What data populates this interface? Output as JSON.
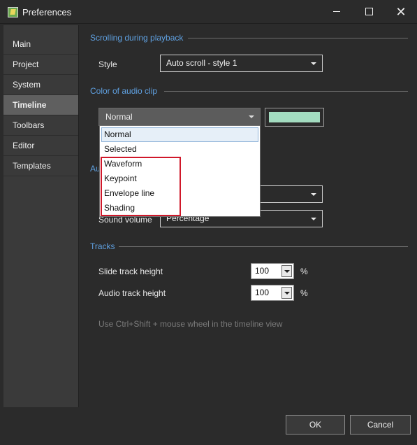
{
  "window": {
    "title": "Preferences",
    "minimize_icon": "minimize-icon",
    "maximize_icon": "maximize-icon",
    "close_glyph": "✕"
  },
  "sidebar": {
    "items": [
      {
        "label": "Main"
      },
      {
        "label": "Project"
      },
      {
        "label": "System"
      },
      {
        "label": "Timeline",
        "selected": true
      },
      {
        "label": "Toolbars"
      },
      {
        "label": "Editor"
      },
      {
        "label": "Templates"
      }
    ]
  },
  "scrolling": {
    "section_title": "Scrolling during playback",
    "style_label": "Style",
    "style_value": "Auto scroll - style 1"
  },
  "audio_color": {
    "section_title": "Color of audio clip",
    "selected_value": "Normal",
    "swatch_color": "#a3dcc0",
    "options": [
      "Normal",
      "Selected",
      "Waveform",
      "Keypoint",
      "Envelope line",
      "Shading"
    ],
    "highlighted_option": "Normal"
  },
  "audio": {
    "section_title_partial": "Au",
    "sound_volume_label": "Sound volume",
    "sound_volume_value": "Percentage"
  },
  "tracks": {
    "section_title": "Tracks",
    "slide_height_label": "Slide track height",
    "slide_height_value": "100",
    "audio_height_label": "Audio track height",
    "audio_height_value": "100",
    "unit": "%",
    "hint": "Use Ctrl+Shift + mouse wheel in the timeline view"
  },
  "footer": {
    "ok_label": "OK",
    "cancel_label": "Cancel"
  },
  "colors": {
    "accent": "#5fa0e0",
    "highlight_box": "#d0182a",
    "background": "#2b2b2b"
  }
}
